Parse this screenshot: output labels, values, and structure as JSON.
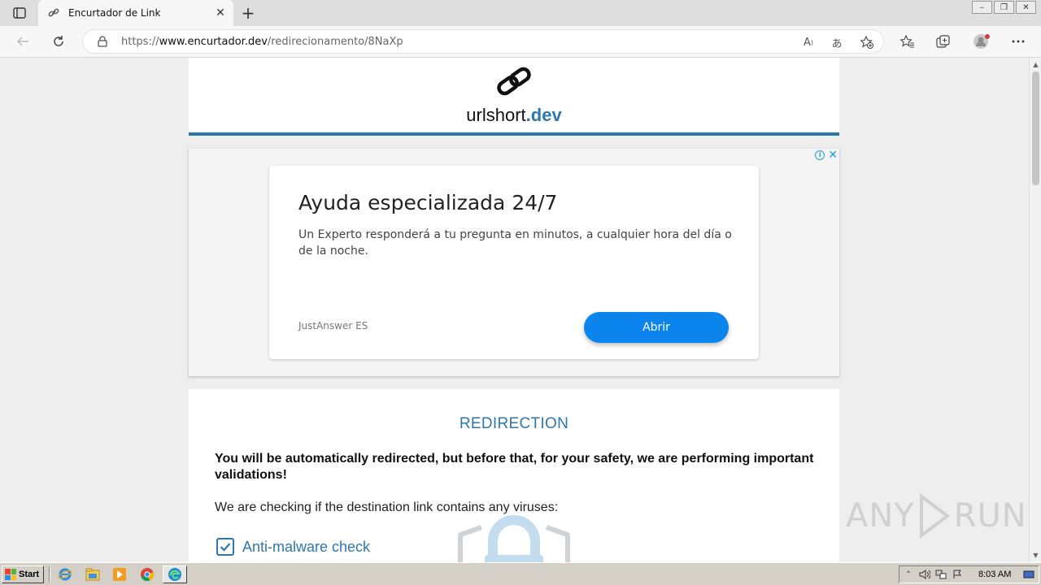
{
  "browser": {
    "tab": {
      "title": "Encurtador de Link",
      "favicon": "link-icon",
      "close": "✕"
    },
    "new_tab": "+",
    "window_controls": {
      "minimize": "–",
      "restore": "❐",
      "close": "✕"
    },
    "address": {
      "scheme": "https://",
      "host": "www.encurtador.dev",
      "path": "/redirecionamento/8NaXp"
    },
    "toolbar_icons": [
      "back-icon",
      "refresh-icon",
      "lock-icon",
      "read-aloud-icon",
      "translate-icon",
      "add-favorite-icon",
      "favorites-icon",
      "collections-icon",
      "profile-icon",
      "more-icon"
    ]
  },
  "site": {
    "logo_name": "urlshort",
    "logo_tld": ".dev"
  },
  "ad": {
    "title": "Ayuda especializada 24/7",
    "description": "Un Experto responderá a tu pregunta en minutos, a cualquier hora del día o de la noche.",
    "advertiser": "JustAnswer ES",
    "button": "Abrir",
    "info": "i",
    "close": "✕"
  },
  "redirection": {
    "title": "REDIRECTION",
    "warning": "You will be automatically redirected, but before that, for your safety, we are performing important validations!",
    "checking": "We are checking if the destination link contains any viruses:",
    "checks": [
      {
        "label": "Anti-malware check",
        "checked": true
      }
    ]
  },
  "watermark": {
    "text_left": "ANY",
    "text_right": "RUN"
  },
  "taskbar": {
    "start": "Start",
    "clock": "8:03 AM",
    "quicklaunch": [
      "ie-icon",
      "explorer-icon",
      "media-player-icon",
      "chrome-icon",
      "edge-icon"
    ]
  },
  "colors": {
    "accent": "#2e77ad",
    "ad_button": "#0b84ee",
    "ad_controls": "#1aa1e6"
  }
}
